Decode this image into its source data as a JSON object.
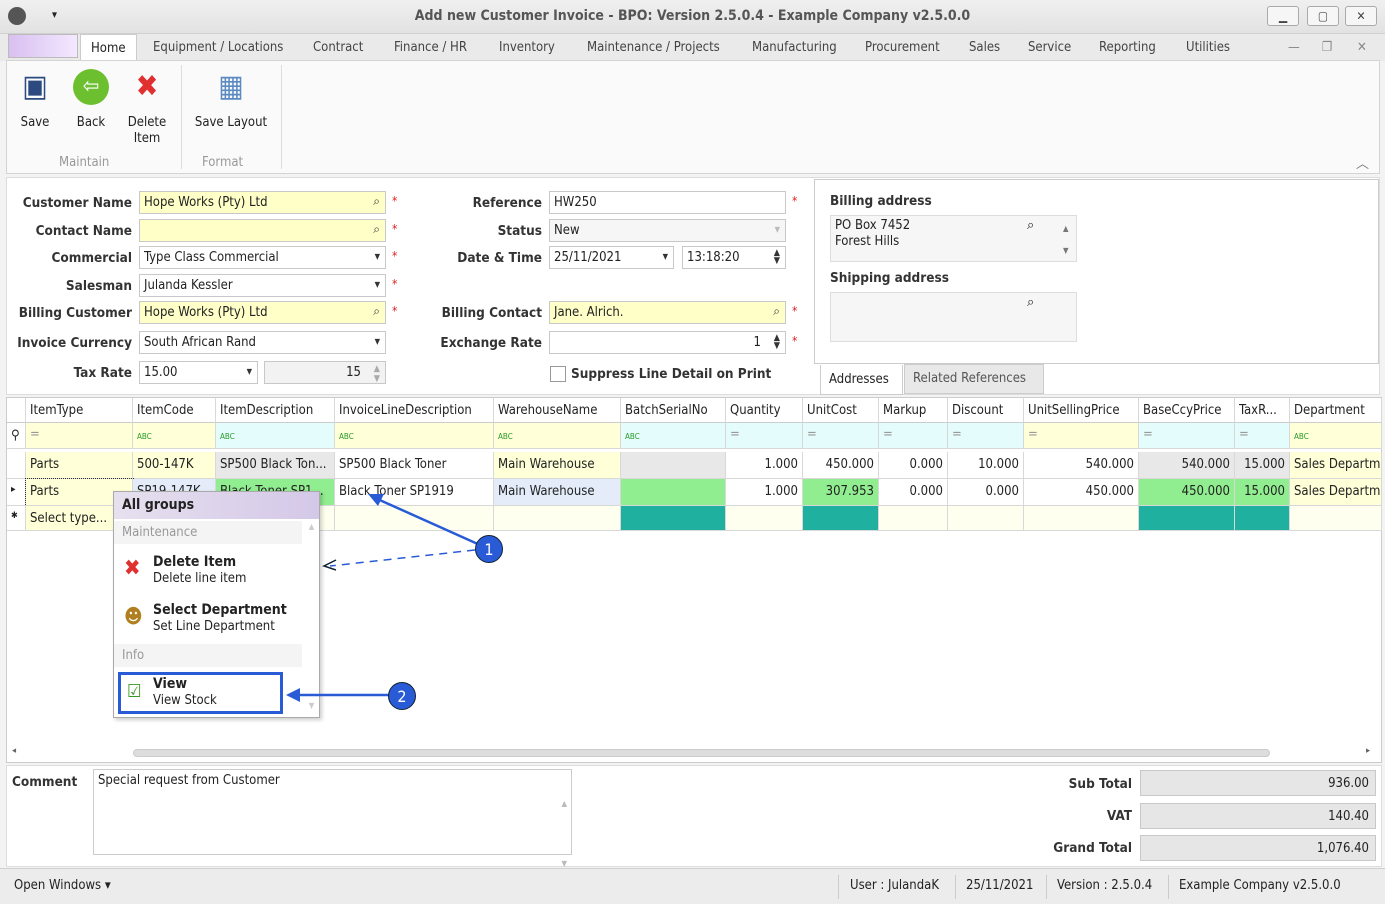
{
  "window": {
    "title": "Add new Customer Invoice - BPO: Version 2.5.0.4 - Example Company v2.5.0.0",
    "controls": [
      "minimize",
      "maximize",
      "close"
    ]
  },
  "menu_tabs": [
    "Home",
    "Equipment / Locations",
    "Contract",
    "Finance / HR",
    "Inventory",
    "Maintenance / Projects",
    "Manufacturing",
    "Procurement",
    "Sales",
    "Service",
    "Reporting",
    "Utilities"
  ],
  "ribbon": {
    "buttons": [
      {
        "label": "Save",
        "icon": "save-icon"
      },
      {
        "label": "Back",
        "icon": "back-arrow-icon"
      },
      {
        "label": "Delete Item",
        "icon": "delete-x-icon"
      },
      {
        "label": "Save Layout",
        "icon": "save-layout-icon"
      }
    ],
    "groups": [
      "Maintain",
      "Format"
    ]
  },
  "form": {
    "customer_name": {
      "label": "Customer Name",
      "value": "Hope Works (Pty) Ltd"
    },
    "contact_name": {
      "label": "Contact Name",
      "value": ""
    },
    "commercial": {
      "label": "Commercial",
      "value": "Type Class Commercial"
    },
    "salesman": {
      "label": "Salesman",
      "value": "Julanda Kessler"
    },
    "billing_customer": {
      "label": "Billing Customer",
      "value": "Hope Works (Pty) Ltd"
    },
    "invoice_currency": {
      "label": "Invoice Currency",
      "value": "South African Rand"
    },
    "tax_rate": {
      "label": "Tax Rate",
      "value": "15.00",
      "value2": "15"
    },
    "reference": {
      "label": "Reference",
      "value": "HW250"
    },
    "status": {
      "label": "Status",
      "value": "New"
    },
    "date_time": {
      "label": "Date & Time",
      "date": "25/11/2021",
      "time": "13:18:20"
    },
    "billing_contact": {
      "label": "Billing Contact",
      "value": "Jane. Alrich."
    },
    "exchange_rate": {
      "label": "Exchange Rate",
      "value": "1"
    },
    "suppress": {
      "label": "Suppress Line Detail on Print",
      "checked": false
    },
    "required_mark": "*"
  },
  "addresses": {
    "billing_label": "Billing address",
    "billing_lines": [
      "PO Box 7452",
      "Forest Hills"
    ],
    "shipping_label": "Shipping address",
    "shipping_lines": [],
    "tabs": [
      "Addresses",
      "Related References"
    ]
  },
  "grid": {
    "columns": [
      "ItemType",
      "ItemCode",
      "ItemDescription",
      "InvoiceLineDescription",
      "WarehouseName",
      "BatchSerialNo",
      "Quantity",
      "UnitCost",
      "Markup",
      "Discount",
      "UnitSellingPrice",
      "BaseCcyPrice",
      "TaxR...",
      "Department"
    ],
    "filter_row": [
      "=",
      "ABC",
      "ABC",
      "ABC",
      "ABC",
      "ABC",
      "=",
      "=",
      "=",
      "=",
      "=",
      "=",
      "=",
      "ABC"
    ],
    "rows": [
      [
        "Parts",
        "500-147K",
        "SP500 Black Ton...",
        "SP500 Black Toner",
        "Main Warehouse",
        "",
        "1.000",
        "450.000",
        "0.000",
        "10.000",
        "540.000",
        "540.000",
        "15.000",
        "Sales Departm"
      ],
      [
        "Parts",
        "SP19-147K",
        "Black Toner SP1...",
        "Black Toner SP1919",
        "Main Warehouse",
        "",
        "1.000",
        "307.953",
        "0.000",
        "0.000",
        "450.000",
        "450.000",
        "15.000",
        "Sales Departm"
      ]
    ],
    "new_row": "Select type..."
  },
  "context_menu": {
    "header": "All groups",
    "groups": [
      {
        "label": "Maintenance",
        "items": [
          {
            "title": "Delete Item",
            "subtitle": "Delete line item",
            "icon": "delete-x-icon"
          },
          {
            "title": "Select Department",
            "subtitle": "Set Line Department",
            "icon": "department-person-icon"
          }
        ]
      },
      {
        "label": "Info",
        "items": [
          {
            "title": "View",
            "subtitle": "View Stock",
            "icon": "check-icon"
          }
        ]
      }
    ]
  },
  "callouts": [
    "1",
    "2"
  ],
  "comment": {
    "label": "Comment",
    "value": "Special request from Customer"
  },
  "totals": {
    "sub_total": {
      "label": "Sub Total",
      "value": "936.00"
    },
    "vat": {
      "label": "VAT",
      "value": "140.40"
    },
    "grand_total": {
      "label": "Grand Total",
      "value": "1,076.40"
    }
  },
  "statusbar": {
    "open_windows": "Open Windows",
    "user": "User : JulandaK",
    "date": "25/11/2021",
    "version": "Version : 2.5.0.4",
    "company": "Example Company v2.5.0.0"
  },
  "colors": {
    "required": "#e02020",
    "callout": "#2a5bd7",
    "yellow_cell": "#ffffc8",
    "green_cell": "#90ee90",
    "teal_cell": "#20b0a0"
  }
}
